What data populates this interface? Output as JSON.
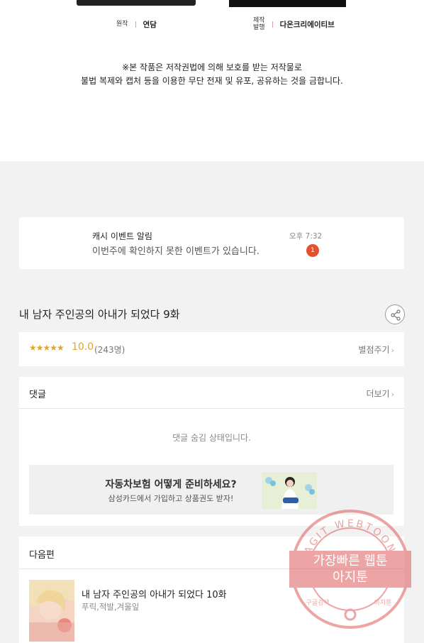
{
  "credits": {
    "original_role": "원작",
    "original_name": "연담",
    "production_role": "제작\n발행",
    "production_name": "다온크리에이티브"
  },
  "copyright": {
    "line1": "※본 작품은 저작권법에 의해 보호를 받는 저작물로",
    "line2": "불법 복제와 캡처 등을 이용한 무단 전재 및 유포, 공유하는 것을 금합니다."
  },
  "notice": {
    "title": "캐시 이벤트 알림",
    "message": "이번주에 확인하지 못한 이벤트가 있습니다.",
    "time": "오후 7:32",
    "badge": "1"
  },
  "episode": {
    "title": "내 남자 주인공의 아내가 되었다 9화",
    "share_icon": "share-icon"
  },
  "rating": {
    "stars": "★★★★★",
    "star_level": 5,
    "score": "10.0",
    "count": "(243명)",
    "give_label": "별점주기",
    "color": "#e7a420"
  },
  "comments": {
    "label": "댓글",
    "more_label": "더보기",
    "hidden_text": "댓글 숨김 상태입니다."
  },
  "ad": {
    "headline": "자동차보험 어떻게 준비하세요?",
    "subtext": "삼성카드에서 가입하고 상품권도 받자!"
  },
  "next": {
    "label": "다음편",
    "title": "내 남자 주인공의 아내가 되었다 10화",
    "authors": "푸릭,적발,겨울잎"
  },
  "watermark": {
    "arc_text": "AGIT WEBTOON",
    "line1": "가장빠른 웹툰",
    "line2": "아지툰",
    "bottom_left": "구글검색",
    "bottom_right": "아지툰",
    "color": "#e05a5a"
  },
  "colors": {
    "badge": "#e5502d",
    "page_bg": "#f2f2f2"
  }
}
